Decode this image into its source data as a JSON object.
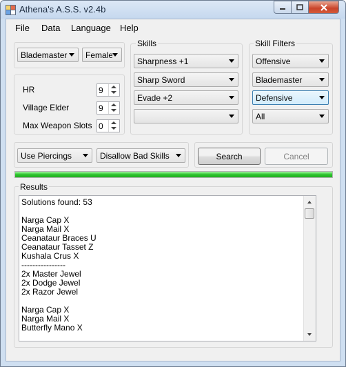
{
  "window": {
    "title": "Athena's A.S.S. v2.4b",
    "icon": "app-grid-icon"
  },
  "menu": [
    "File",
    "Data",
    "Language",
    "Help"
  ],
  "hunter": {
    "weapon_type": "Blademaster",
    "gender": "Female"
  },
  "stats": [
    {
      "label": "HR",
      "value": "9"
    },
    {
      "label": "Village Elder",
      "value": "9"
    },
    {
      "label": "Max Weapon Slots",
      "value": "0"
    }
  ],
  "skills": {
    "label": "Skills",
    "values": [
      "Sharpness +1",
      "Sharp Sword",
      "Evade +2",
      ""
    ]
  },
  "skill_filters": {
    "label": "Skill Filters",
    "values": [
      "Offensive",
      "Blademaster",
      "Defensive",
      "All"
    ]
  },
  "options": {
    "piercings": "Use Piercings",
    "bad_skills": "Disallow Bad Skills"
  },
  "buttons": {
    "search": "Search",
    "cancel": "Cancel"
  },
  "progress": {
    "percent": 100,
    "color": "#2cc42c"
  },
  "results": {
    "label": "Results",
    "lines": [
      "Solutions found: 53",
      "",
      "Narga Cap X",
      "Narga Mail X",
      "Ceanataur Braces U",
      "Ceanataur Tasset Z",
      "Kushala Crus X",
      "----------------",
      "2x Master Jewel",
      "2x Dodge Jewel",
      "2x Razor Jewel",
      "",
      "Narga Cap X",
      "Narga Mail X",
      "Butterfly Mano X"
    ]
  }
}
